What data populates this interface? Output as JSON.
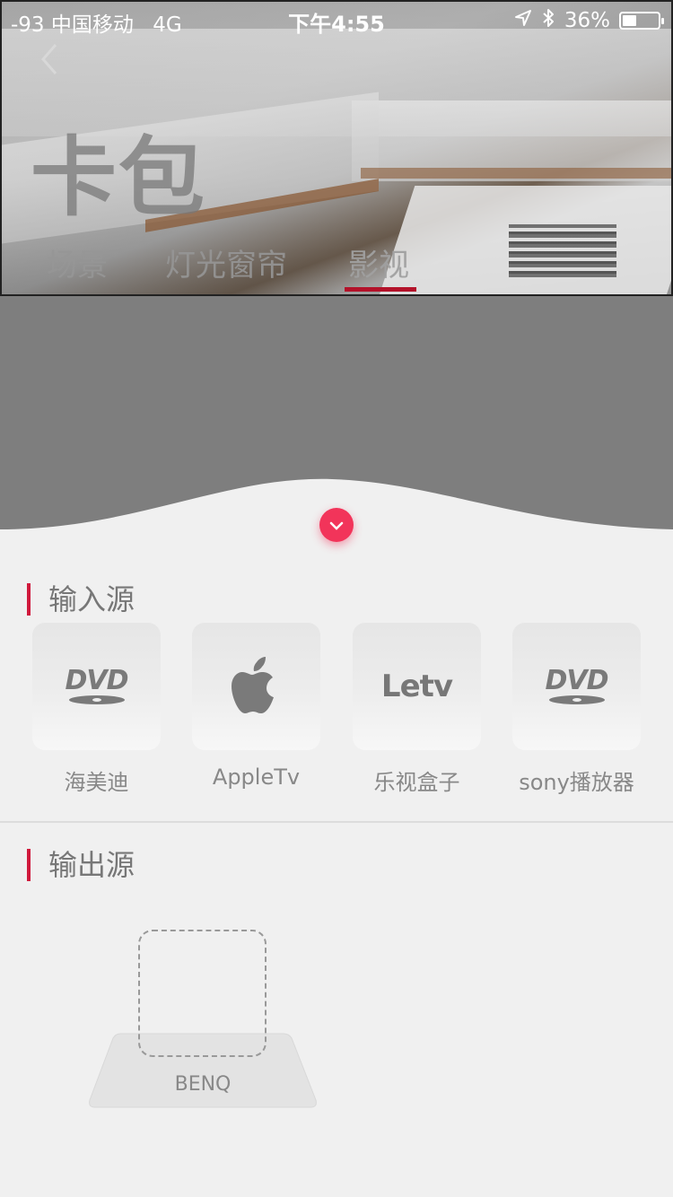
{
  "status_bar": {
    "carrier": "-93 中国移动",
    "network": "4G",
    "time": "下午4:55",
    "battery_percent": "36%",
    "battery_level": 0.36,
    "icons": [
      "location-arrow-icon",
      "bluetooth-icon",
      "battery-icon"
    ]
  },
  "header": {
    "back_icon": "chevron-left-icon",
    "title": "卡包",
    "tabs": [
      {
        "label": "场景",
        "active": false
      },
      {
        "label": "灯光窗帘",
        "active": false
      },
      {
        "label": "影视",
        "active": true
      }
    ],
    "active_color": "#b3122a"
  },
  "collapse_button": {
    "icon": "chevron-down-icon",
    "color": "#f2345a"
  },
  "input_section": {
    "title": "输入源",
    "sources": [
      {
        "label": "海美迪",
        "icon": "dvd-logo-icon"
      },
      {
        "label": "AppleTv",
        "icon": "apple-logo-icon"
      },
      {
        "label": "乐视盒子",
        "icon": "letv-logo-icon",
        "logo_text": "Letv"
      },
      {
        "label": "sony播放器",
        "icon": "dvd-logo-icon"
      }
    ],
    "dvd_logo_text": "DVD"
  },
  "output_section": {
    "title": "输出源",
    "device_label": "BENQ"
  },
  "colors": {
    "accent": "#d0193c"
  }
}
